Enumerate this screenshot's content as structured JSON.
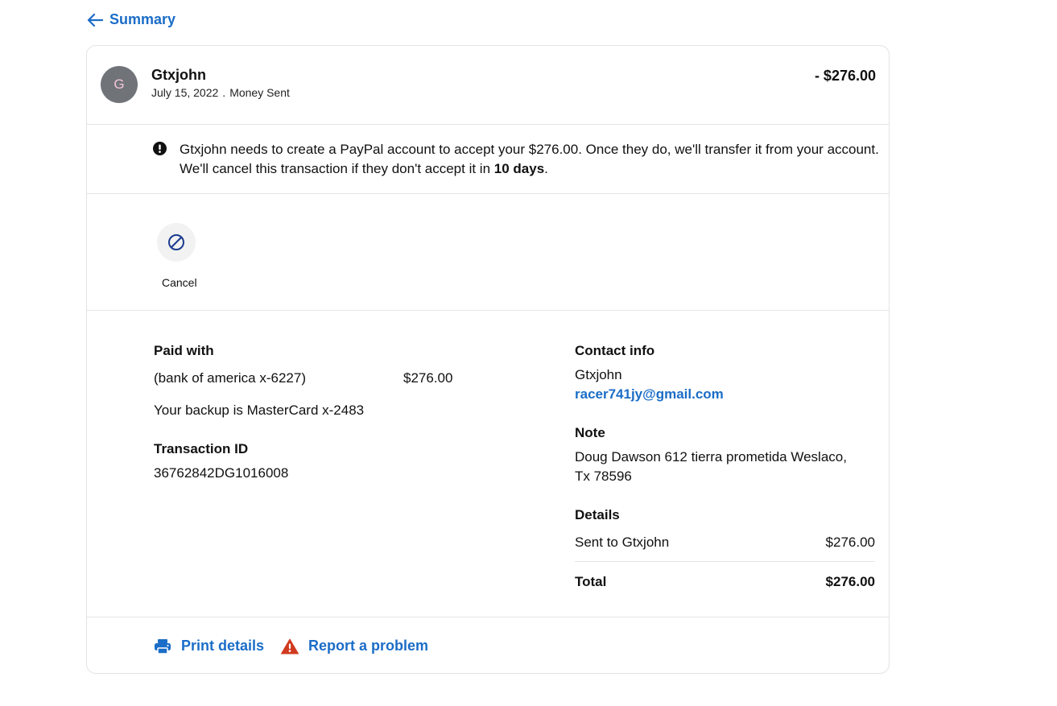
{
  "nav": {
    "back_label": "Summary"
  },
  "header": {
    "avatar_initial": "G",
    "name": "Gtxjohn",
    "date": "July 15, 2022",
    "separator": ".",
    "type": "Money Sent",
    "amount": "- $276.00"
  },
  "alert": {
    "text_before": "Gtxjohn needs to create a PayPal account to accept your $276.00. Once they do, we'll transfer it from your account. We'll cancel this transaction if they don't accept it in ",
    "bold_text": "10 days",
    "text_after": "."
  },
  "actions": {
    "cancel_label": "Cancel"
  },
  "payment": {
    "paid_with_label": "Paid with",
    "source": "(bank of america x-6227)",
    "source_amount": "$276.00",
    "backup": "Your backup is MasterCard x-2483",
    "transaction_id_label": "Transaction ID",
    "transaction_id": "36762842DG1016008"
  },
  "contact": {
    "label": "Contact info",
    "name": "Gtxjohn",
    "email": "racer741jy@gmail.com"
  },
  "note": {
    "label": "Note",
    "line1": "Doug Dawson 612 tierra prometida Weslaco,",
    "line2": "Tx 78596"
  },
  "details": {
    "label": "Details",
    "sent_to_label": "Sent to Gtxjohn",
    "sent_to_amount": "$276.00",
    "total_label": "Total",
    "total_amount": "$276.00"
  },
  "footer": {
    "print_label": "Print details",
    "report_label": "Report a problem"
  },
  "colors": {
    "link": "#1b6dc7",
    "avatar_bg": "#707478",
    "warning_icon": "#d03a1f",
    "cancel_icon": "#1a3b8e"
  },
  "icons": {
    "back": "arrow-left-icon",
    "alert": "exclamation-circle-icon",
    "cancel": "cancel-circle-slash-icon",
    "print": "printer-icon",
    "report": "warning-triangle-icon"
  }
}
